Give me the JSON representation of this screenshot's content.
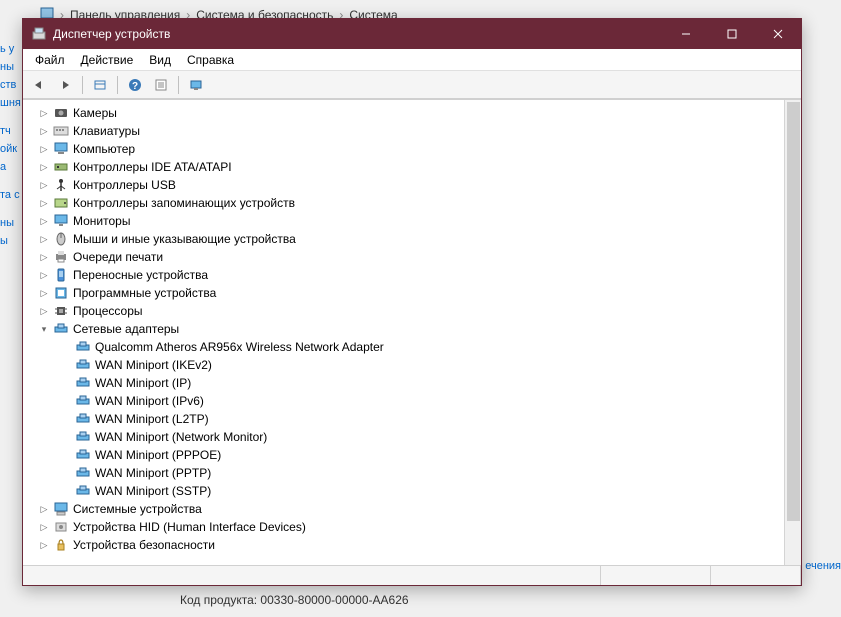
{
  "bg": {
    "breadcrumb": [
      "Панель управления",
      "Система и безопасность",
      "Система"
    ],
    "left_fragments": [
      "ь у",
      "ны",
      "ств",
      "шня",
      "тч",
      "ойк",
      "а",
      "та с",
      "ны",
      "ы"
    ],
    "right_fragment": "ечения",
    "product_label": "Код продукта:",
    "product_value": "00330-80000-00000-AA626"
  },
  "window": {
    "title": "Диспетчер устройств",
    "menus": [
      "Файл",
      "Действие",
      "Вид",
      "Справка"
    ],
    "toolbar_icons": [
      "back",
      "forward",
      "sep",
      "show-hidden",
      "sep",
      "help",
      "properties",
      "sep",
      "monitor"
    ]
  },
  "tree": {
    "top": [
      {
        "label": "Камеры",
        "icon": "camera",
        "expandable": true
      },
      {
        "label": "Клавиатуры",
        "icon": "keyboard",
        "expandable": true
      },
      {
        "label": "Компьютер",
        "icon": "computer",
        "expandable": true
      },
      {
        "label": "Контроллеры IDE ATA/ATAPI",
        "icon": "ide",
        "expandable": true
      },
      {
        "label": "Контроллеры USB",
        "icon": "usb",
        "expandable": true
      },
      {
        "label": "Контроллеры запоминающих устройств",
        "icon": "storage",
        "expandable": true
      },
      {
        "label": "Мониторы",
        "icon": "monitor",
        "expandable": true
      },
      {
        "label": "Мыши и иные указывающие устройства",
        "icon": "mouse",
        "expandable": true
      },
      {
        "label": "Очереди печати",
        "icon": "printer",
        "expandable": true
      },
      {
        "label": "Переносные устройства",
        "icon": "portable",
        "expandable": true
      },
      {
        "label": "Программные устройства",
        "icon": "software",
        "expandable": true
      },
      {
        "label": "Процессоры",
        "icon": "cpu",
        "expandable": true
      }
    ],
    "network": {
      "label": "Сетевые адаптеры",
      "icon": "network",
      "expanded": true,
      "children": [
        "Qualcomm Atheros AR956x Wireless Network Adapter",
        "WAN Miniport (IKEv2)",
        "WAN Miniport (IP)",
        "WAN Miniport (IPv6)",
        "WAN Miniport (L2TP)",
        "WAN Miniport (Network Monitor)",
        "WAN Miniport (PPPOE)",
        "WAN Miniport (PPTP)",
        "WAN Miniport (SSTP)"
      ]
    },
    "bottom": [
      {
        "label": "Системные устройства",
        "icon": "system",
        "expandable": true
      },
      {
        "label": "Устройства HID (Human Interface Devices)",
        "icon": "hid",
        "expandable": true
      },
      {
        "label": "Устройства безопасности",
        "icon": "security",
        "expandable": true
      }
    ]
  },
  "twisty": {
    "collapsed": "▷",
    "expanded": "▾"
  }
}
